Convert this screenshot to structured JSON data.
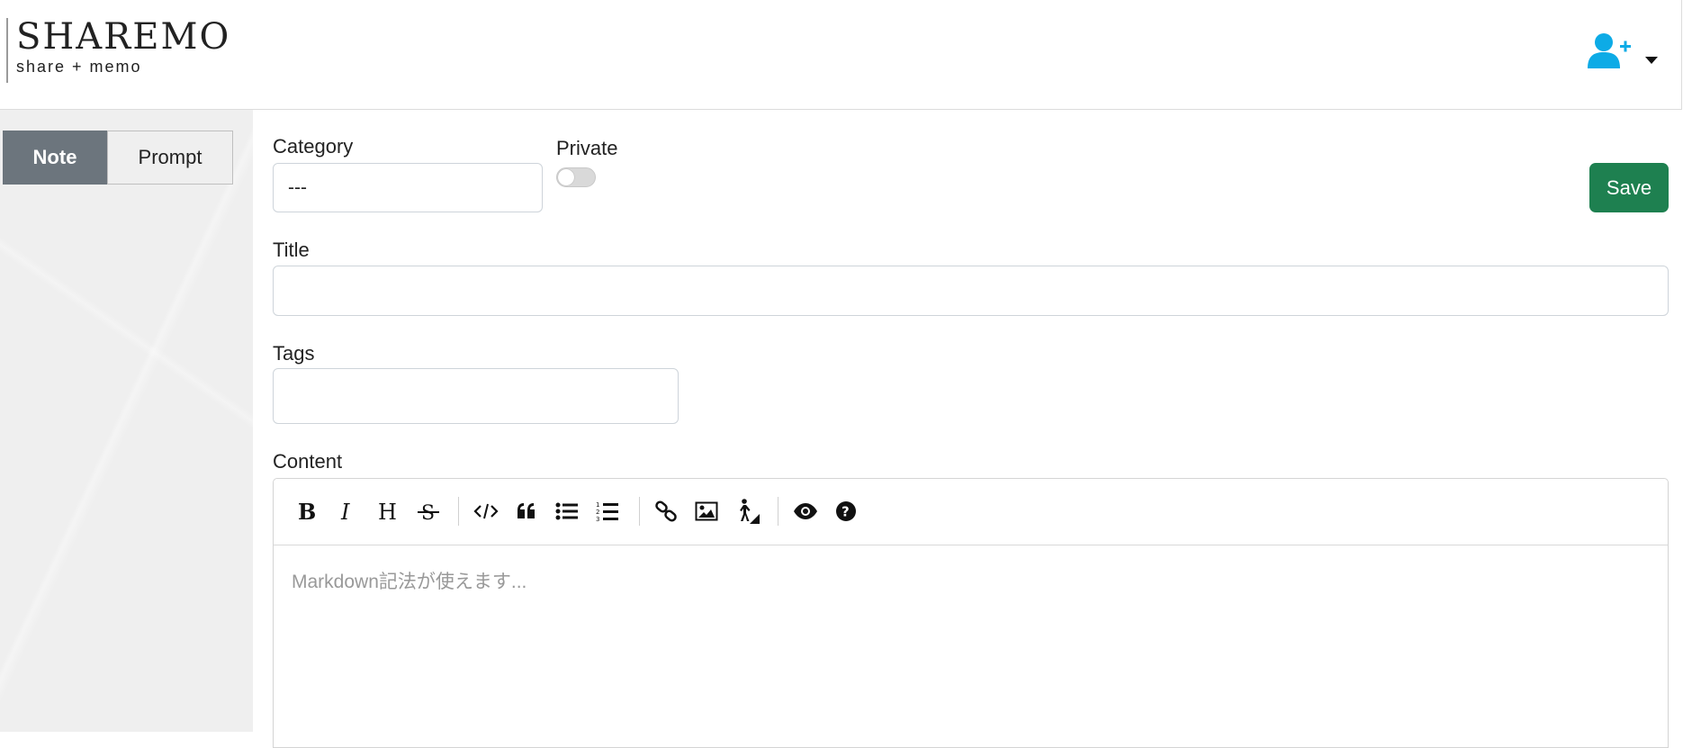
{
  "header": {
    "logo_main": "SHAREMO",
    "logo_sub": "share + memo",
    "user_menu_icon": "user-plus-icon",
    "accent_color": "#0dabe6"
  },
  "sidebar": {
    "toggle": [
      {
        "label": "Note",
        "active": true
      },
      {
        "label": "Prompt",
        "active": false
      }
    ]
  },
  "form": {
    "category_label": "Category",
    "category_value": "---",
    "private_label": "Private",
    "private_on": false,
    "save_label": "Save",
    "title_label": "Title",
    "title_value": "",
    "tags_label": "Tags",
    "tags_value": "",
    "content_label": "Content",
    "content_placeholder": "Markdown記法が使えます...",
    "save_color": "#1e8050"
  },
  "toolbar": {
    "buttons": [
      "bold-icon",
      "italic-icon",
      "heading-icon",
      "strikethrough-icon",
      "code-icon",
      "quote-icon",
      "unordered-list-icon",
      "ordered-list-icon",
      "link-icon",
      "image-icon",
      "accessibility-icon",
      "preview-icon",
      "help-icon"
    ]
  }
}
